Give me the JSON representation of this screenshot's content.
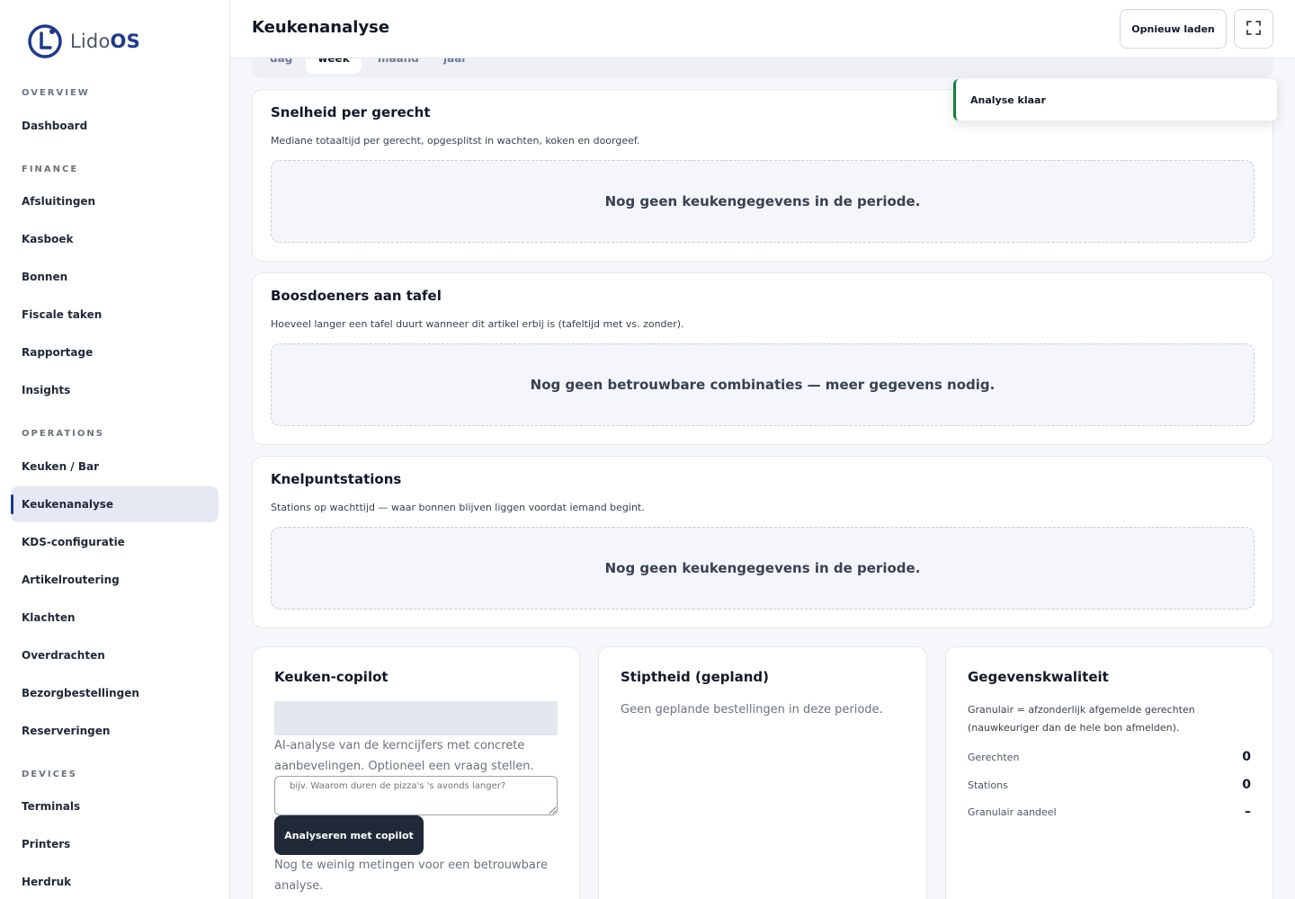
{
  "app": {
    "logo_prefix": "Lido",
    "logo_suffix": "OS"
  },
  "sidebar": {
    "sections": [
      {
        "label": "OVERVIEW"
      },
      {
        "label": "FINANCE"
      },
      {
        "label": "OPERATIONS"
      },
      {
        "label": "DEVICES"
      }
    ],
    "items": [
      {
        "label": "Dashboard"
      },
      {
        "label": "Afsluitingen"
      },
      {
        "label": "Kasboek"
      },
      {
        "label": "Bonnen"
      },
      {
        "label": "Fiscale taken"
      },
      {
        "label": "Rapportage"
      },
      {
        "label": "Insights"
      },
      {
        "label": "Keuken / Bar"
      },
      {
        "label": "Keukenanalyse",
        "active": true
      },
      {
        "label": "KDS-configuratie"
      },
      {
        "label": "Artikelroutering"
      },
      {
        "label": "Klachten"
      },
      {
        "label": "Overdrachten"
      },
      {
        "label": "Bezorgbestellingen"
      },
      {
        "label": "Reserveringen"
      },
      {
        "label": "Terminals"
      },
      {
        "label": "Printers"
      },
      {
        "label": "Herdruk"
      }
    ]
  },
  "header": {
    "title": "Keukenanalyse",
    "reload_label": "Opnieuw laden",
    "expand_icon": "fullscreen-icon"
  },
  "period_tabs": [
    {
      "label": "dag"
    },
    {
      "label": "week",
      "active": true
    },
    {
      "label": "maand"
    },
    {
      "label": "jaar"
    }
  ],
  "toast": {
    "text": "Analyse klaar",
    "accent": "#15803d"
  },
  "cards": {
    "speed": {
      "title": "Snelheid per gerecht",
      "subtitle": "Mediane totaaltijd per gerecht, opgesplitst in wachten, koken en doorgeef.",
      "empty": "Nog geen keukengegevens in de periode."
    },
    "culprits": {
      "title": "Boosdoeners aan tafel",
      "subtitle": "Hoeveel langer een tafel duurt wanneer dit artikel erbij is (tafeltijd met vs. zonder).",
      "empty": "Nog geen betrouwbare combinaties — meer gegevens nodig."
    },
    "bottlenecks": {
      "title": "Knelpuntstations",
      "subtitle": "Stations op wachttijd — waar bonnen blijven liggen voordat iemand begint.",
      "empty": "Nog geen keukengegevens in de periode."
    }
  },
  "copilot": {
    "title": "Keuken-copilot",
    "description": "AI-analyse van de kerncijfers met concrete aanbevelingen. Optioneel een vraag stellen.",
    "placeholder": "bijv. Waarom duren de pizza's 's avonds langer?",
    "button": "Analyseren met copilot",
    "note": "Nog te weinig metingen voor een betrouwbare analyse."
  },
  "punctuality": {
    "title": "Stiptheid (gepland)",
    "text": "Geen geplande bestellingen in deze periode."
  },
  "data_quality": {
    "title": "Gegevenskwaliteit",
    "description": "Granulair = afzonderlijk afgemelde gerechten (nauwkeuriger dan de hele bon afmelden).",
    "stats": [
      {
        "label": "Gerechten",
        "value": "0"
      },
      {
        "label": "Stations",
        "value": "0"
      },
      {
        "label": "Granulair aandeel",
        "value": "–"
      }
    ]
  },
  "colors": {
    "brand": "#1e3a8a",
    "active_bg": "#e6e9f3",
    "button_dark": "#1f2937"
  }
}
